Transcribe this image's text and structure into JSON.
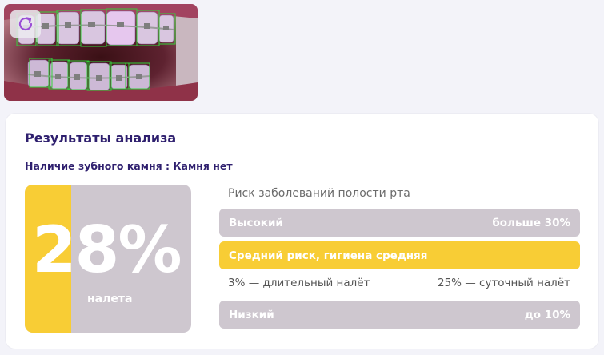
{
  "photo": {
    "retry_icon": "refresh-icon"
  },
  "results": {
    "title": "Результаты анализа",
    "tartar_line": "Наличие зубного камня : Камня нет",
    "plaque_percent": "28%",
    "plaque_fraction": 0.28,
    "plaque_caption": "налета"
  },
  "risk": {
    "title": "Риск заболеваний полости рта",
    "high_label": "Высокий",
    "high_value": "больше 30%",
    "mid_label": "Средний риск, гигиена средняя",
    "long_plaque": "3% — длительный налёт",
    "daily_plaque": "25% — суточный налёт",
    "low_label": "Низкий",
    "low_value": "до 10%"
  },
  "colors": {
    "accent_yellow": "#f8cd35",
    "muted_gray": "#cec7cf",
    "title_purple": "#2e1f6e",
    "retry_purple": "#9b4fd6"
  }
}
